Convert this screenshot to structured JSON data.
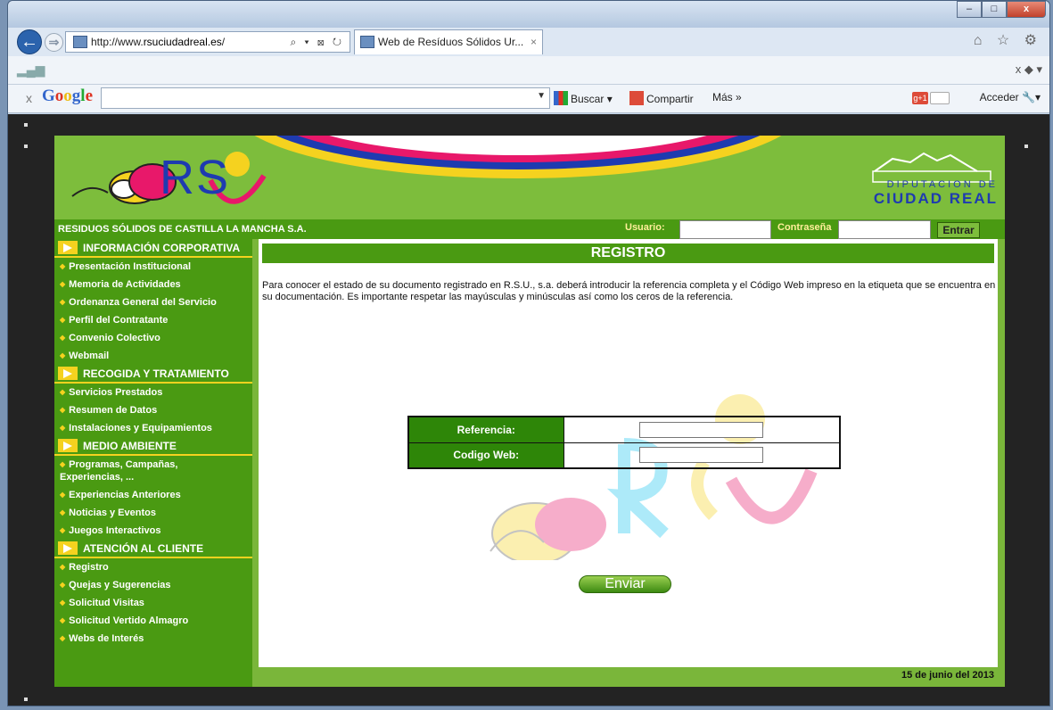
{
  "browser": {
    "address_prefix": "http://www.",
    "address_domain": "rsuciudadreal.es",
    "address_suffix": "/",
    "address_tools": "⌕ ▾ ⊠ ↻",
    "tab_title": "Web de Resíduos Sólidos Ur...",
    "tab_close": "×",
    "top_icons": "⌂ ☆ ⚙",
    "minimize": "–",
    "maximize": "□",
    "close": "x",
    "back": "←",
    "forward": "⇒",
    "bar2_right": "x ◆ ▾"
  },
  "google_toolbar": {
    "close": "x",
    "logo": [
      "G",
      "o",
      "o",
      "g",
      "l",
      "e"
    ],
    "buscar": "Buscar",
    "compartir": "Compartir",
    "mas": "Más »",
    "gplus": "g+1",
    "acceder": "Acceder"
  },
  "site": {
    "logo_text": "RS",
    "diputacion_small": "DIPUTACION DE",
    "diputacion_big": "CIUDAD REAL",
    "company": "RESIDUOS SÓLIDOS DE CASTILLA LA MANCHA S.A.",
    "user_label": "Usuario:",
    "password_label": "Contraseña",
    "login_button": "Entrar"
  },
  "sidebar": {
    "sections": [
      {
        "title": "INFORMACIÓN CORPORATIVA",
        "items": [
          "Presentación Institucional",
          "Memoria de Actividades",
          "Ordenanza General del Servicio",
          "Perfil del Contratante",
          "Convenio Colectivo",
          "Webmail"
        ]
      },
      {
        "title": "RECOGIDA Y TRATAMIENTO",
        "items": [
          "Servicios Prestados",
          "Resumen de Datos",
          "Instalaciones y Equipamientos"
        ]
      },
      {
        "title": "MEDIO AMBIENTE",
        "items": [
          "Programas, Campañas, Experiencias, ...",
          "Experiencias Anteriores",
          "Noticias y Eventos",
          "Juegos Interactivos"
        ]
      },
      {
        "title": "ATENCIÓN AL CLIENTE",
        "items": [
          "Registro",
          "Quejas y Sugerencias",
          "Solicitud Visitas",
          "Solicitud Vertido Almagro",
          "Webs de Interés"
        ]
      }
    ]
  },
  "main": {
    "title": "REGISTRO",
    "intro": "Para conocer el estado de su documento registrado en R.S.U., s.a. deberá introducir la referencia completa y el Código Web impreso en la etiqueta que se encuentra en su documentación. Es importante respetar las mayúsculas y minúsculas así como los ceros de la referencia.",
    "referencia_label": "Referencia:",
    "codigo_label": "Codigo Web:",
    "submit": "Enviar"
  },
  "footer": {
    "date": "15 de junio del 2013"
  },
  "colors": {
    "green": "#4a9a12",
    "light_green": "#7dbd3c",
    "yellow": "#f5d21f",
    "blue": "#1e3bb0"
  }
}
